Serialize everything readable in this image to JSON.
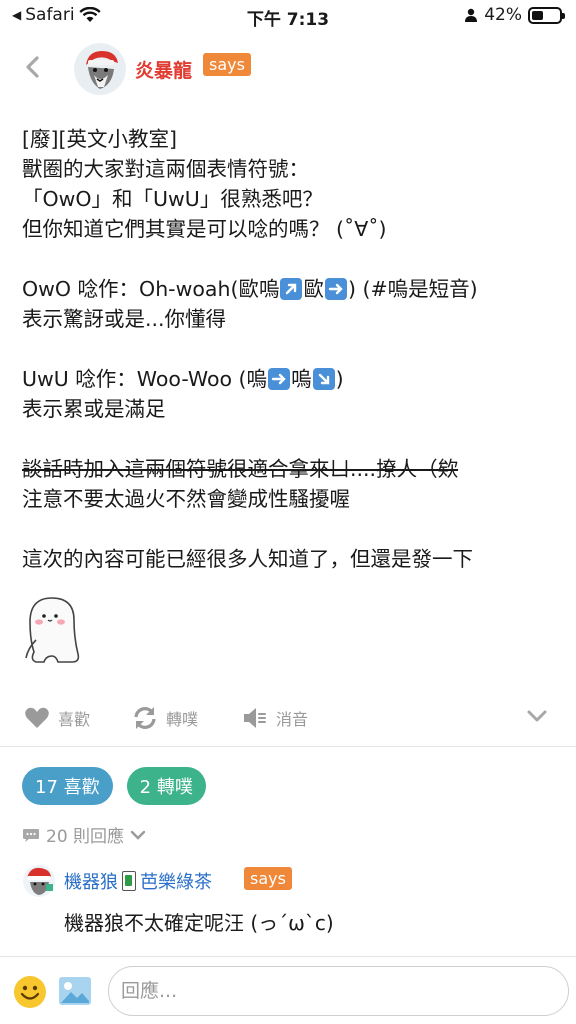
{
  "status_bar": {
    "carrier": "Safari",
    "time": "下午 7:13",
    "battery": "42%",
    "battery_level": 0.42
  },
  "header": {
    "author_name": "炎暴龍",
    "says": "says"
  },
  "post": {
    "lines_block1": "[廢][英文小教室]\n獸圈的大家對這兩個表情符號：\n「OwO」和「UwU」很熟悉吧？\n但你知道它們其實是可以唸的嗎？ (˚∀˚)",
    "owo_line_a": "OwO 唸作：Oh-woah(歐嗚",
    "owo_line_b": "歐",
    "owo_line_c": ") (#嗚是短音)",
    "owo_line2": "表示驚訝或是...你懂得",
    "uwu_line_a": "UwU 唸作：Woo-Woo (嗚",
    "uwu_line_b": "嗚",
    "uwu_line_c": ")",
    "uwu_line2": "表示累或是滿足",
    "strike_line": "談話時加入這兩個符號很適合拿來ㄩ....撩人（欸",
    "warning_line": "注意不要太過火不然會變成性騷擾喔",
    "closing_line": "這次的內容可能已經很多人知道了，但還是發一下"
  },
  "actions": {
    "like": "喜歡",
    "repost": "轉噗",
    "mute": "消音"
  },
  "stats": {
    "likes": "17 喜歡",
    "reposts": "2 轉噗"
  },
  "replies_toggle": "20 則回應",
  "reply": {
    "name": "機器狼",
    "name_suffix": "芭樂綠茶",
    "says": "says",
    "text": "機器狼不太確定呢汪 (っ´ω`c)"
  },
  "composer": {
    "placeholder": "回應..."
  },
  "colors": {
    "author": "#e03c32",
    "says_badge": "#f0883a",
    "like_pill": "#4a9fc8",
    "repost_pill": "#3cb38b",
    "reply_name": "#2a6fc9"
  }
}
